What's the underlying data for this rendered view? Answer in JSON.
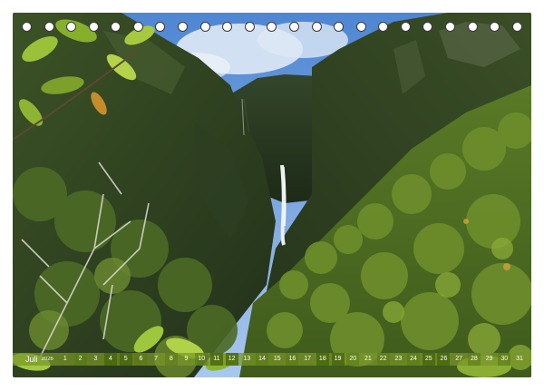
{
  "calendar": {
    "month": "Juli",
    "year": "2026",
    "days": [
      "1",
      "2",
      "3",
      "4",
      "5",
      "6",
      "7",
      "8",
      "9",
      "10",
      "11",
      "12",
      "13",
      "14",
      "15",
      "16",
      "17",
      "18",
      "19",
      "20",
      "21",
      "22",
      "23",
      "24",
      "25",
      "26",
      "27",
      "28",
      "29",
      "30",
      "31"
    ]
  },
  "binding": {
    "ring_count": 23
  },
  "colors": {
    "sky": "#5b8fd6",
    "cliff_dark": "#2d3d22",
    "forest": "#4d6b22",
    "foliage_light": "#9cc23a",
    "strip": "#7a9628"
  }
}
